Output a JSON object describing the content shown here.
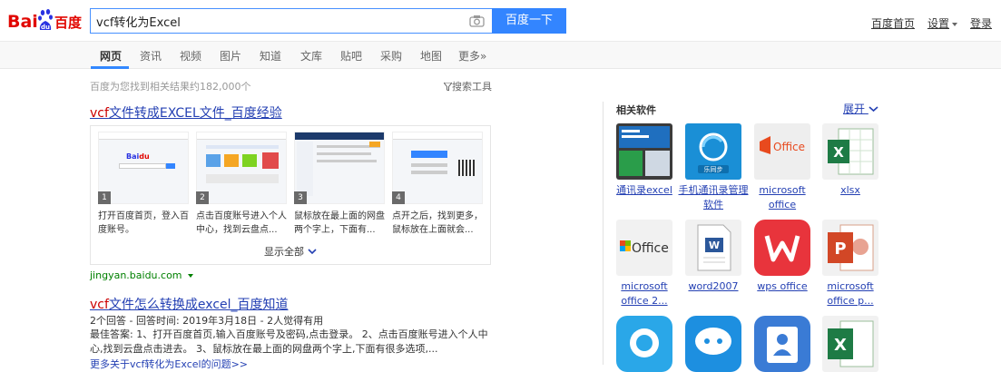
{
  "search": {
    "query": "vcf转化为Excel",
    "button_label": "百度一下"
  },
  "logo": {
    "text_left": "Bai",
    "text_du": "du",
    "text_right": "百度"
  },
  "top_links": {
    "home": "百度首页",
    "settings": "设置",
    "login": "登录"
  },
  "tabs": [
    {
      "label": "网页",
      "active": true
    },
    {
      "label": "资讯"
    },
    {
      "label": "视频"
    },
    {
      "label": "图片"
    },
    {
      "label": "知道"
    },
    {
      "label": "文库"
    },
    {
      "label": "贴吧"
    },
    {
      "label": "采购"
    },
    {
      "label": "地图"
    },
    {
      "label": "更多»"
    }
  ],
  "result_count": "百度为您找到相关结果约182,000个",
  "search_tools": "搜索工具",
  "results": [
    {
      "title_hl": "vcf",
      "title_rest": "文件转成EXCEL文件_百度经验",
      "steps": [
        {
          "num": "1",
          "text": "打开百度首页，登入百度账号。"
        },
        {
          "num": "2",
          "text": "点击百度账号进入个人中心，找到云盘点..."
        },
        {
          "num": "3",
          "text": "鼠标放在最上面的网盘两个字上，下面有..."
        },
        {
          "num": "4",
          "text": "点开之后，找到更多，鼠标放在上面就会..."
        }
      ],
      "show_all": "显示全部",
      "source": "jingyan.baidu.com"
    },
    {
      "title_hl": "vcf",
      "title_rest": "文件怎么转换成excel_百度知道",
      "meta": "2个回答 - 回答时间: 2019年3月18日 - 2人觉得有用",
      "abstract": "最佳答案: 1、打开百度首页,输入百度账号及密码,点击登录。 2、点击百度账号进入个人中心,找到云盘点击进去。 3、鼠标放在最上面的网盘两个字上,下面有很多选项,...",
      "more": "更多关于vcf转化为Excel的问题>>"
    }
  ],
  "sidebar": {
    "title": "相关软件",
    "expand": "展开",
    "apps": [
      {
        "label": "通讯录excel",
        "icon": "contacts-excel-icon"
      },
      {
        "label": "手机通讯录管理软件",
        "icon": "phone-contacts-sync-icon"
      },
      {
        "label": "microsoft office",
        "icon": "microsoft-office-icon"
      },
      {
        "label": "xlsx",
        "icon": "xlsx-file-icon"
      },
      {
        "label": "microsoft office 2...",
        "icon": "office-logo-icon"
      },
      {
        "label": "word2007",
        "icon": "word-document-icon"
      },
      {
        "label": "wps office",
        "icon": "wps-office-icon"
      },
      {
        "label": "microsoft office p...",
        "icon": "powerpoint-icon"
      },
      {
        "label": "",
        "icon": "chat-app-icon"
      },
      {
        "label": "",
        "icon": "messenger-app-icon"
      },
      {
        "label": "",
        "icon": "contacts-app-icon"
      },
      {
        "label": "",
        "icon": "excel-app-icon"
      }
    ]
  },
  "colors": {
    "accent": "#3385ff",
    "link": "#2440b3",
    "highlight": "#c00000",
    "source": "#008000"
  }
}
